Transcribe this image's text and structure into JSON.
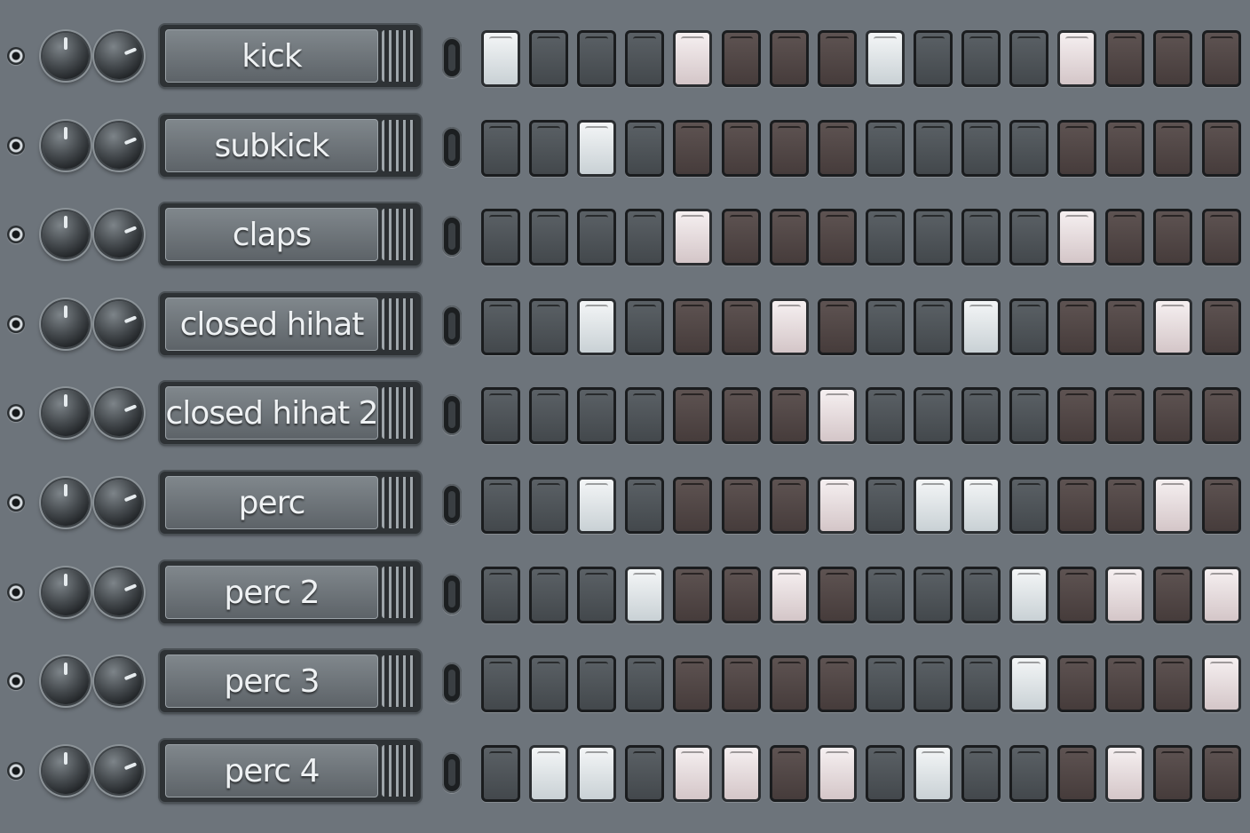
{
  "channel_rack": {
    "step_groups": [
      "a",
      "a",
      "a",
      "a",
      "b",
      "b",
      "b",
      "b",
      "a",
      "a",
      "a",
      "a",
      "b",
      "b",
      "b",
      "b"
    ],
    "channels": [
      {
        "name": "kick",
        "steps": [
          1,
          0,
          0,
          0,
          1,
          0,
          0,
          0,
          1,
          0,
          0,
          0,
          1,
          0,
          0,
          0
        ]
      },
      {
        "name": "subkick",
        "steps": [
          0,
          0,
          1,
          0,
          0,
          0,
          0,
          0,
          0,
          0,
          0,
          0,
          0,
          0,
          0,
          0
        ]
      },
      {
        "name": "claps",
        "steps": [
          0,
          0,
          0,
          0,
          1,
          0,
          0,
          0,
          0,
          0,
          0,
          0,
          1,
          0,
          0,
          0
        ]
      },
      {
        "name": "closed hihat",
        "steps": [
          0,
          0,
          1,
          0,
          0,
          0,
          1,
          0,
          0,
          0,
          1,
          0,
          0,
          0,
          1,
          0
        ]
      },
      {
        "name": "closed hihat 2",
        "steps": [
          0,
          0,
          0,
          0,
          0,
          0,
          0,
          1,
          0,
          0,
          0,
          0,
          0,
          0,
          0,
          0
        ]
      },
      {
        "name": "perc",
        "steps": [
          0,
          0,
          1,
          0,
          0,
          0,
          0,
          1,
          0,
          1,
          1,
          0,
          0,
          0,
          1,
          0
        ]
      },
      {
        "name": "perc 2",
        "steps": [
          0,
          0,
          0,
          1,
          0,
          0,
          1,
          0,
          0,
          0,
          0,
          1,
          0,
          1,
          0,
          1
        ]
      },
      {
        "name": "perc 3",
        "steps": [
          0,
          0,
          0,
          0,
          0,
          0,
          0,
          0,
          0,
          0,
          0,
          1,
          0,
          0,
          0,
          1
        ]
      },
      {
        "name": "perc 4",
        "steps": [
          0,
          1,
          1,
          0,
          1,
          1,
          0,
          1,
          0,
          1,
          0,
          0,
          0,
          1,
          0,
          0
        ]
      }
    ]
  }
}
